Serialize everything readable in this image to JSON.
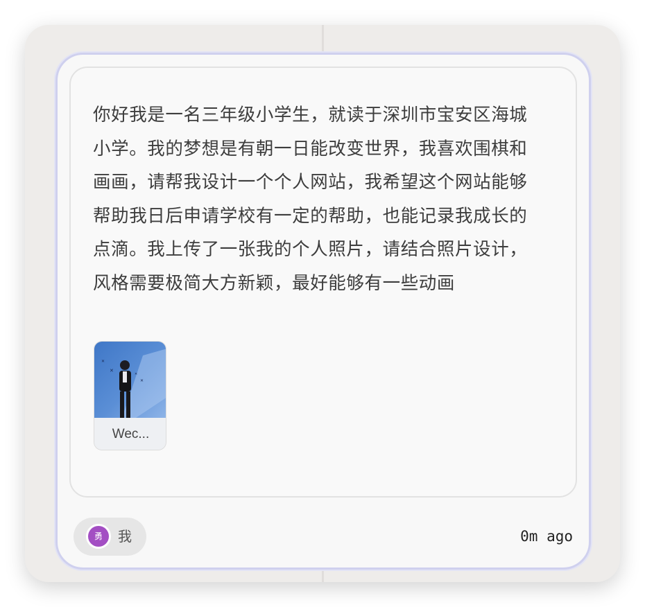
{
  "message": {
    "text": "你好我是一名三年级小学生，就读于深圳市宝安区海城小学。我的梦想是有朝一日能改变世界，我喜欢围棋和画画，请帮我设计一个个人网站，我希望这个网站能够帮助我日后申请学校有一定的帮助，也能记录我成长的点滴。我上传了一张我的个人照片，请结合照片设计，风格需要极简大方新颖，最好能够有一些动画"
  },
  "attachment": {
    "name": "Wec..."
  },
  "user": {
    "avatar_text": "勇",
    "label": "我",
    "avatar_color": "#a34ec3"
  },
  "timestamp": "0m ago"
}
